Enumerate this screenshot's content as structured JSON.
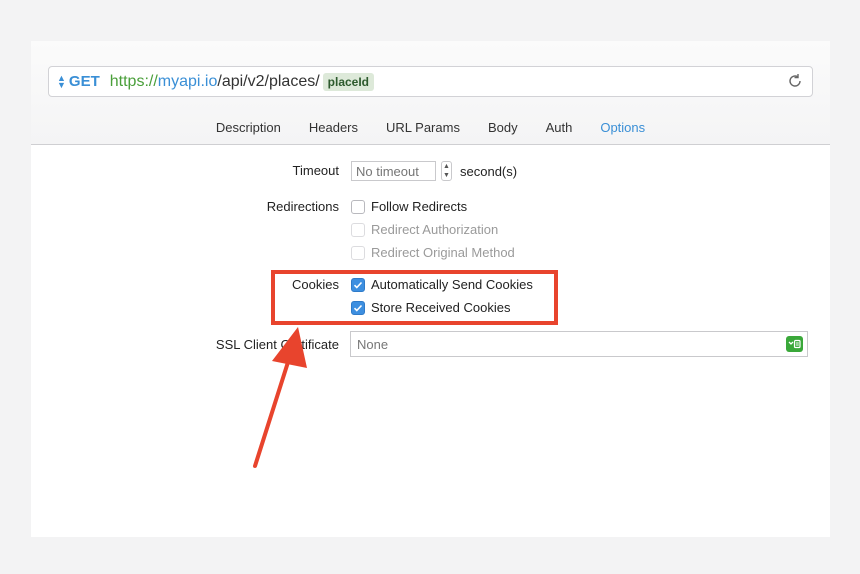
{
  "request": {
    "method": "GET",
    "url_scheme": "https://",
    "url_host": "myapi.io",
    "url_path": "/api/v2/places/",
    "url_token": "placeId"
  },
  "tabs": [
    {
      "label": "Description",
      "active": false
    },
    {
      "label": "Headers",
      "active": false
    },
    {
      "label": "URL Params",
      "active": false
    },
    {
      "label": "Body",
      "active": false
    },
    {
      "label": "Auth",
      "active": false
    },
    {
      "label": "Options",
      "active": true
    }
  ],
  "options": {
    "timeout_label": "Timeout",
    "timeout_placeholder": "No timeout",
    "timeout_unit": "second(s)",
    "redirections_label": "Redirections",
    "redirections": [
      {
        "label": "Follow Redirects",
        "checked": false,
        "enabled": true
      },
      {
        "label": "Redirect Authorization",
        "checked": false,
        "enabled": false
      },
      {
        "label": "Redirect Original Method",
        "checked": false,
        "enabled": false
      }
    ],
    "cookies_label": "Cookies",
    "cookies": [
      {
        "label": "Automatically Send Cookies",
        "checked": true
      },
      {
        "label": "Store Received Cookies",
        "checked": true
      }
    ],
    "ssl_label": "SSL Client Certificate",
    "ssl_value": "None"
  },
  "colors": {
    "accent": "#3a8fd6",
    "highlight": "#e8442d",
    "scheme": "#4a9f3a"
  },
  "icons": {
    "reload": "reload-icon",
    "check": "checkmark-icon",
    "certificate": "certificate-icon"
  }
}
